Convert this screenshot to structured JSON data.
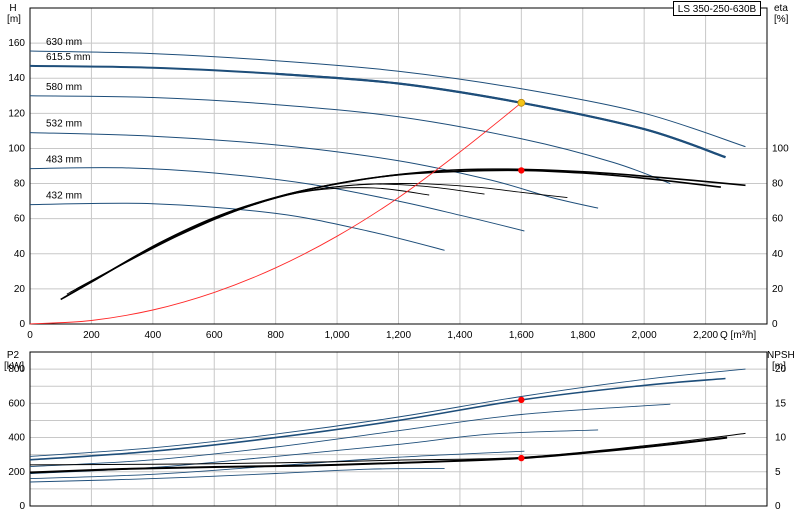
{
  "model_label": "LS 350-250-630B",
  "chart_data": [
    {
      "type": "line",
      "title": "",
      "xlabel": "Q [m³/h]",
      "ylabel_left": [
        "H",
        "[m]"
      ],
      "ylabel_right": [
        "eta",
        "[%]"
      ],
      "xlim": [
        0,
        2400
      ],
      "ylim_left": [
        0,
        180
      ],
      "ylim_right": [
        0,
        180
      ],
      "x_ticks": [
        "0",
        "200",
        "400",
        "600",
        "800",
        "1,000",
        "1,200",
        "1,400",
        "1,600",
        "1,800",
        "2,000",
        "2,200"
      ],
      "x_tick_values": [
        0,
        200,
        400,
        600,
        800,
        1000,
        1200,
        1400,
        1600,
        1800,
        2000,
        2200
      ],
      "y_ticks_left": [
        0,
        20,
        40,
        60,
        80,
        100,
        120,
        140,
        160
      ],
      "y_ticks_right": [
        0,
        20,
        40,
        60,
        80,
        100
      ],
      "grid": true,
      "head_curves": [
        {
          "label": "630 mm",
          "points": [
            [
              0,
              155.5
            ],
            [
              400,
              154
            ],
            [
              800,
              150
            ],
            [
              1200,
              144
            ],
            [
              1600,
              134
            ],
            [
              2000,
              120
            ],
            [
              2330,
              101
            ]
          ]
        },
        {
          "label": "615.5 mm",
          "points": [
            [
              0,
              147
            ],
            [
              400,
              146
            ],
            [
              800,
              142.5
            ],
            [
              1200,
              137
            ],
            [
              1600,
              126
            ],
            [
              2000,
              111
            ],
            [
              2265,
              95
            ]
          ]
        },
        {
          "label": "580 mm",
          "points": [
            [
              0,
              130
            ],
            [
              400,
              129
            ],
            [
              800,
              125
            ],
            [
              1200,
              118
            ],
            [
              1600,
              105.5
            ],
            [
              1900,
              92
            ],
            [
              2085,
              80
            ]
          ]
        },
        {
          "label": "532 mm",
          "points": [
            [
              0,
              109
            ],
            [
              400,
              107
            ],
            [
              800,
              102
            ],
            [
              1200,
              93
            ],
            [
              1500,
              82
            ],
            [
              1700,
              72
            ],
            [
              1850,
              66
            ]
          ]
        },
        {
          "label": "483 mm",
          "points": [
            [
              0,
              88.5
            ],
            [
              300,
              89
            ],
            [
              600,
              86
            ],
            [
              900,
              80
            ],
            [
              1200,
              70
            ],
            [
              1400,
              62
            ],
            [
              1610,
              53
            ]
          ]
        },
        {
          "label": "432 mm",
          "points": [
            [
              0,
              68
            ],
            [
              400,
              68.5
            ],
            [
              800,
              63
            ],
            [
              1100,
              53
            ],
            [
              1350,
              42
            ]
          ]
        }
      ],
      "efficiency_curves": [
        {
          "points": [
            [
              100,
              14
            ],
            [
              200,
              24
            ],
            [
              400,
              44
            ],
            [
              600,
              60
            ],
            [
              800,
              72
            ],
            [
              1000,
              80
            ],
            [
              1200,
              85
            ],
            [
              1400,
              87
            ],
            [
              1600,
              87.5
            ],
            [
              1800,
              86
            ],
            [
              2000,
              83
            ],
            [
              2250,
              78
            ]
          ]
        },
        {
          "points": [
            [
              110,
              15
            ],
            [
              220,
              26
            ],
            [
              420,
              46
            ],
            [
              620,
              62
            ],
            [
              820,
              73
            ],
            [
              1020,
              80.5
            ],
            [
              1220,
              85.5
            ],
            [
              1420,
              88
            ],
            [
              1620,
              88
            ],
            [
              1820,
              86.5
            ],
            [
              2050,
              83.5
            ],
            [
              2330,
              79
            ]
          ]
        },
        {
          "points": [
            [
              120,
              17
            ],
            [
              250,
              29
            ],
            [
              450,
              48
            ],
            [
              650,
              63
            ],
            [
              850,
              74
            ],
            [
              1050,
              79
            ],
            [
              1250,
              80
            ],
            [
              1450,
              78
            ],
            [
              1600,
              75
            ],
            [
              1750,
              72
            ]
          ]
        },
        {
          "points": [
            [
              130,
              18
            ],
            [
              280,
              32
            ],
            [
              480,
              50
            ],
            [
              680,
              65
            ],
            [
              880,
              75
            ],
            [
              1080,
              79.5
            ],
            [
              1280,
              78.5
            ],
            [
              1480,
              74
            ]
          ]
        },
        {
          "points": [
            [
              150,
              20
            ],
            [
              320,
              36
            ],
            [
              520,
              54
            ],
            [
              720,
              68
            ],
            [
              920,
              76
            ],
            [
              1120,
              77.5
            ],
            [
              1300,
              73.5
            ]
          ]
        }
      ],
      "system_curve": {
        "color": "#ff2a2a",
        "points": [
          [
            0,
            0
          ],
          [
            200,
            2
          ],
          [
            400,
            8
          ],
          [
            600,
            18
          ],
          [
            800,
            32
          ],
          [
            1000,
            50
          ],
          [
            1200,
            72
          ],
          [
            1400,
            98
          ],
          [
            1600,
            126
          ]
        ]
      },
      "duty_point_head": {
        "x": 1600,
        "y": 126,
        "color": "#f5c518"
      },
      "duty_point_efficiency": {
        "x": 1600,
        "y": 87.5,
        "color": "#ff0000"
      }
    },
    {
      "type": "line",
      "title": "",
      "ylabel_left": [
        "P2",
        "[kW]"
      ],
      "ylabel_right": [
        "NPSH",
        "[m]"
      ],
      "xlim": [
        0,
        2400
      ],
      "ylim_left": [
        0,
        900
      ],
      "ylim_right": [
        0,
        22.5
      ],
      "y_ticks_left": [
        0,
        200,
        400,
        600,
        800
      ],
      "y_ticks_right": [
        0,
        5,
        10,
        15,
        20
      ],
      "grid": true,
      "power_curves": [
        {
          "points": [
            [
              0,
              290
            ],
            [
              400,
              340
            ],
            [
              800,
              420
            ],
            [
              1200,
              520
            ],
            [
              1600,
              640
            ],
            [
              2000,
              740
            ],
            [
              2330,
              800
            ]
          ]
        },
        {
          "points": [
            [
              0,
              270
            ],
            [
              400,
              320
            ],
            [
              800,
              400
            ],
            [
              1200,
              500
            ],
            [
              1600,
              620
            ],
            [
              2000,
              705
            ],
            [
              2265,
              745
            ]
          ]
        },
        {
          "points": [
            [
              0,
              230
            ],
            [
              400,
              270
            ],
            [
              800,
              345
            ],
            [
              1200,
              440
            ],
            [
              1600,
              535
            ],
            [
              2085,
              595
            ]
          ]
        },
        {
          "points": [
            [
              0,
              190
            ],
            [
              400,
              225
            ],
            [
              800,
              290
            ],
            [
              1200,
              360
            ],
            [
              1500,
              420
            ],
            [
              1850,
              445
            ]
          ]
        },
        {
          "points": [
            [
              0,
              160
            ],
            [
              400,
              185
            ],
            [
              800,
              235
            ],
            [
              1200,
              285
            ],
            [
              1610,
              320
            ]
          ]
        },
        {
          "points": [
            [
              0,
              140
            ],
            [
              400,
              160
            ],
            [
              800,
              190
            ],
            [
              1100,
              215
            ],
            [
              1350,
              220
            ]
          ]
        }
      ],
      "npsh_curves": [
        {
          "points": [
            [
              0,
              6
            ],
            [
              400,
              6.1
            ],
            [
              800,
              6.3
            ],
            [
              1200,
              6.7
            ],
            [
              1600,
              7.1
            ],
            [
              2000,
              8.8
            ],
            [
              2330,
              10.6
            ]
          ]
        },
        {
          "points": [
            [
              0,
              4.9
            ],
            [
              300,
              5.4
            ],
            [
              600,
              5.7
            ],
            [
              900,
              5.9
            ],
            [
              1200,
              6.3
            ],
            [
              1600,
              7
            ],
            [
              2000,
              8.6
            ],
            [
              2270,
              10
            ]
          ]
        }
      ],
      "duty_point_power": {
        "x": 1600,
        "y": 620,
        "color": "#ff0000"
      },
      "duty_point_npsh": {
        "x": 1600,
        "y": 7,
        "color": "#ff0000"
      }
    }
  ]
}
